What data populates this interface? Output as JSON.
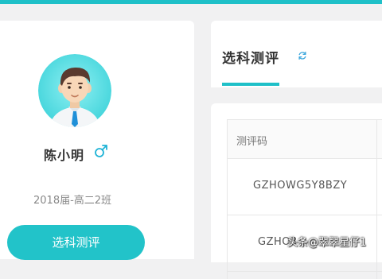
{
  "colors": {
    "accent": "#1fc0c8",
    "button": "#22c3c9",
    "background": "#f1f1f2",
    "card": "#ffffff",
    "text_primary": "#333333",
    "text_secondary": "#888888"
  },
  "profile": {
    "name": "陈小明",
    "gender_icon": "male-icon",
    "class_info": "2018届-高二2班",
    "primary_action": "选科测评"
  },
  "header": {
    "active_tab": "选科测评",
    "refresh_icon": "refresh-icon"
  },
  "table": {
    "columns": [
      "测评码"
    ],
    "rows": [
      {
        "code": "GZHOWG5Y8BZY"
      },
      {
        "code": "GZHO3"
      }
    ]
  },
  "watermark": "头条@翠翠星仔1"
}
